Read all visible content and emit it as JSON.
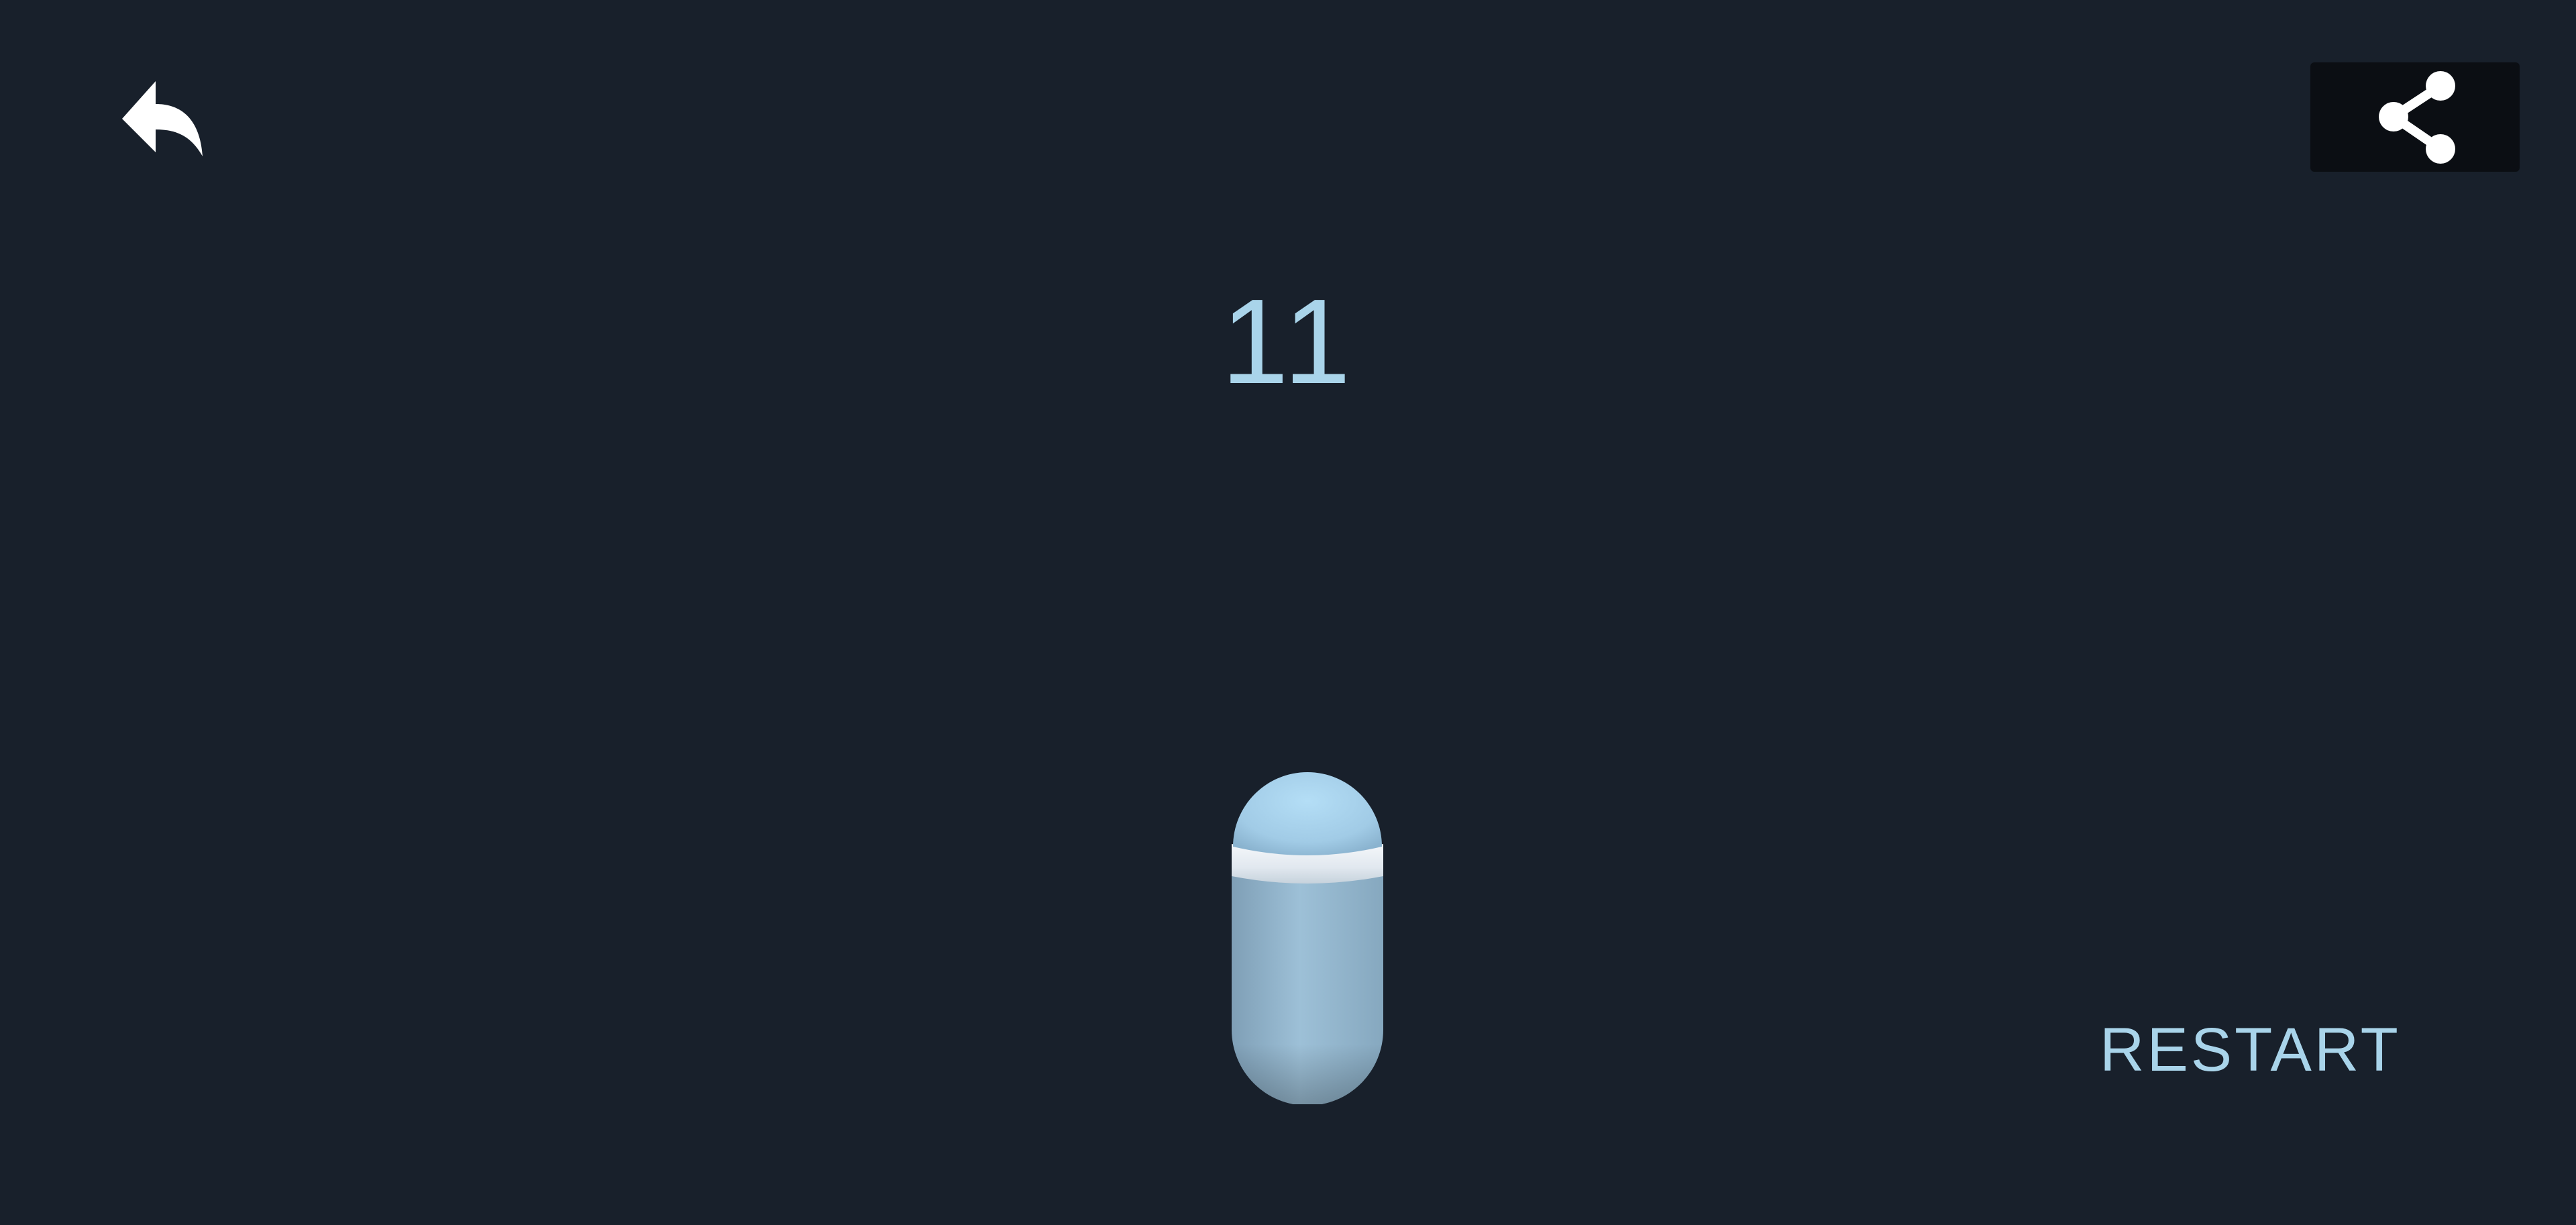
{
  "header": {
    "back_icon": "reply-arrow-icon",
    "share_icon": "share-icon",
    "colors": {
      "background": "#18202b",
      "share_button_bg": "#0b0e13",
      "accent_text": "#a9d4ea",
      "capsule": "#97b9d0"
    }
  },
  "game": {
    "score": "11",
    "player": "capsule-character"
  },
  "controls": {
    "restart_label": "RESTART"
  }
}
